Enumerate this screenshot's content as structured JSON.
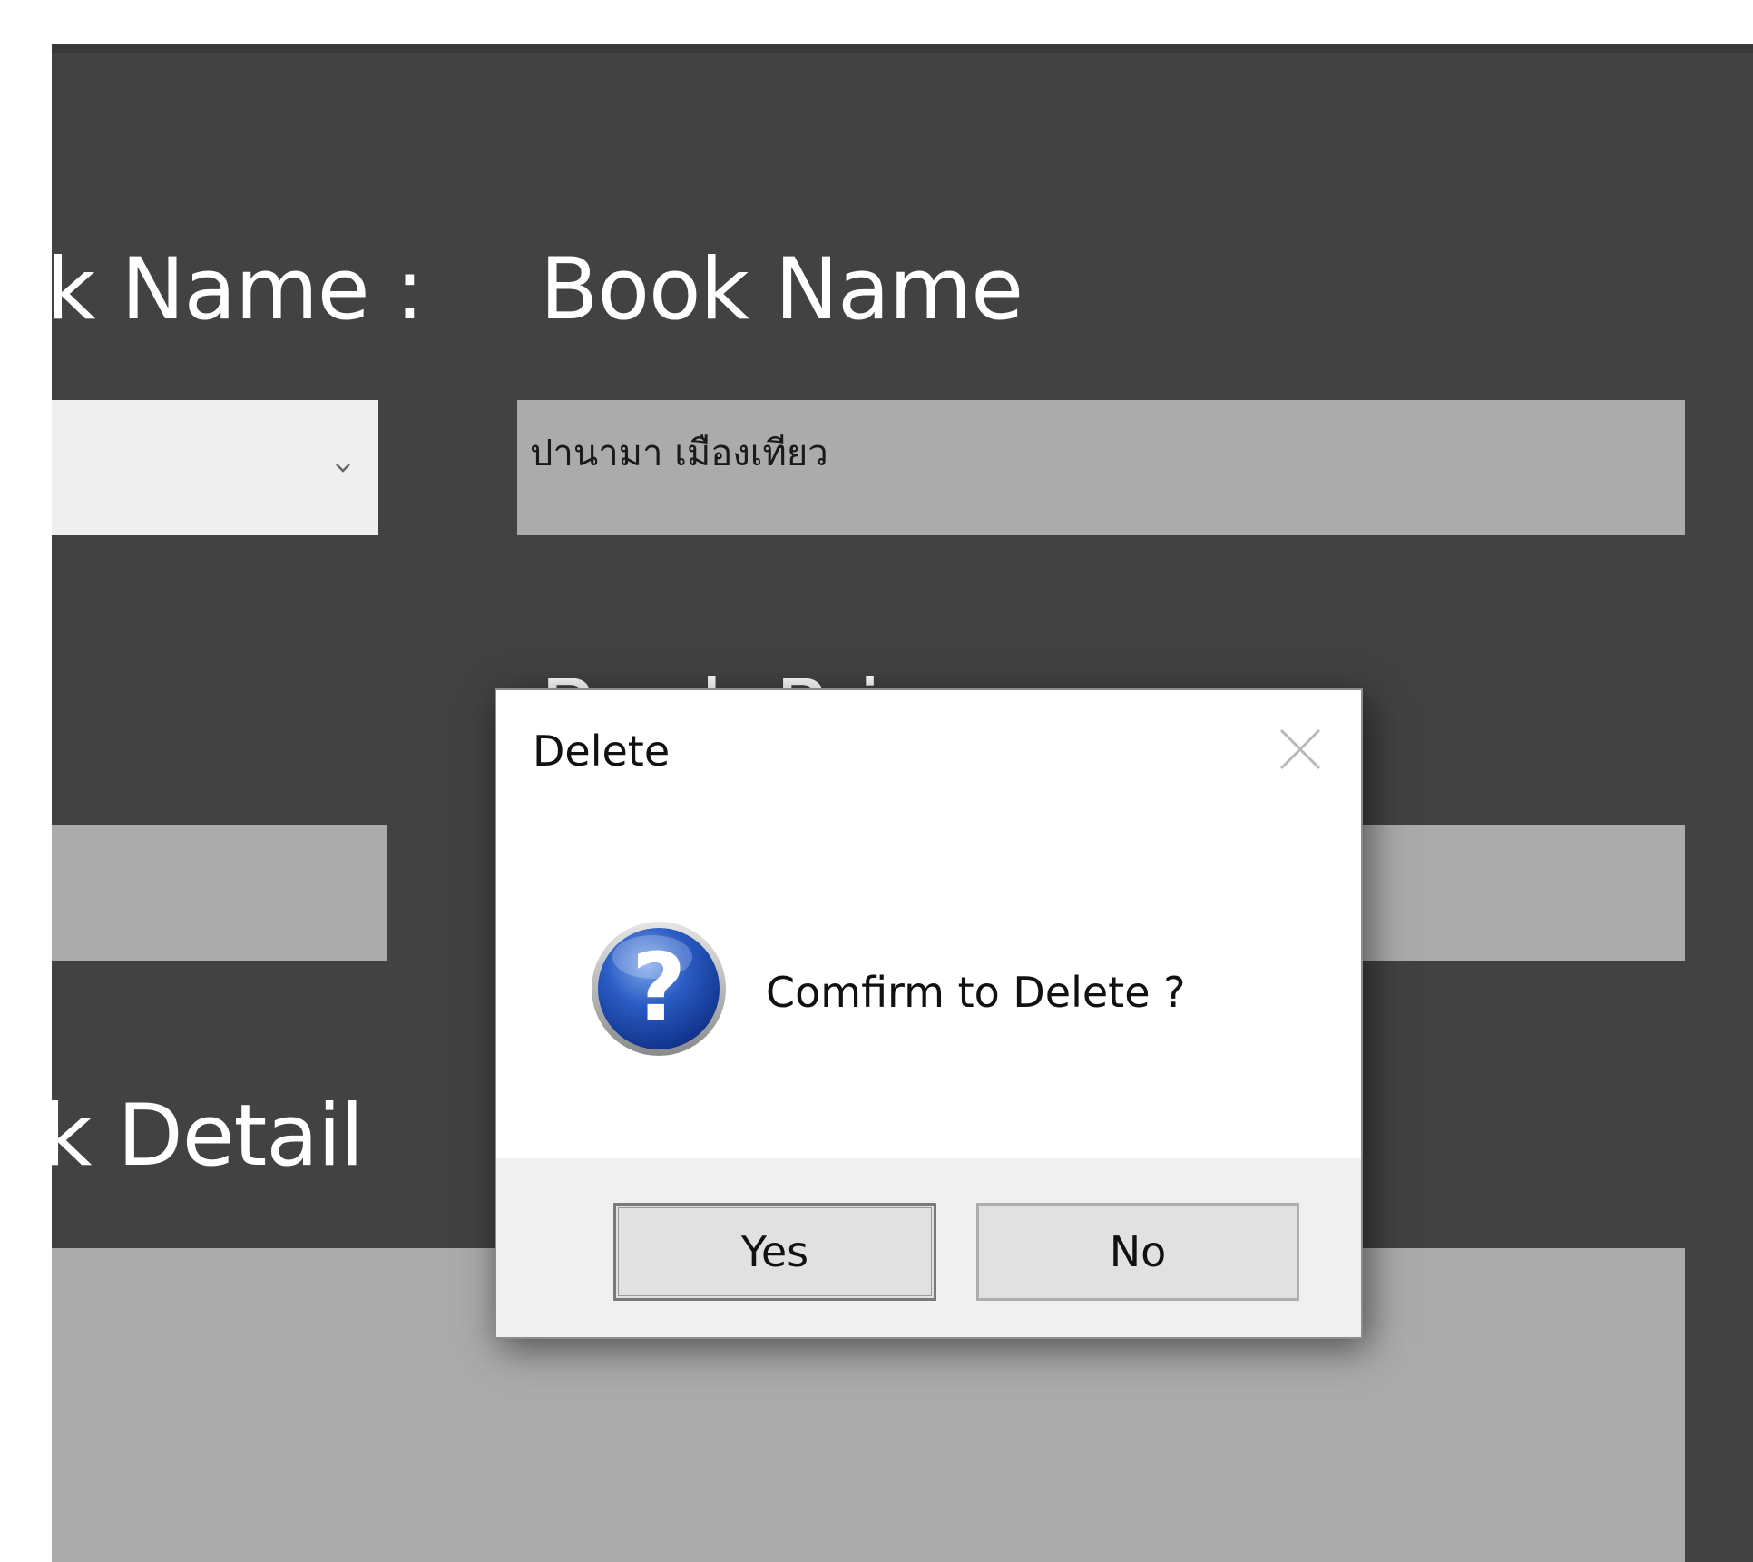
{
  "form": {
    "book_name_label_left": "k Name :",
    "book_name_label": "Book Name",
    "book_name_value": "ปานามา เมืองเทียว",
    "book_price_label_partial": "Book Price",
    "book_detail_label_left": "k Detail"
  },
  "dialog": {
    "title": "Delete",
    "message": "Comfirm to Delete ?",
    "yes_label": "Yes",
    "no_label": "No",
    "icon": "question-icon",
    "close_icon": "close-icon"
  },
  "colors": {
    "window_bg": "#424242",
    "field_bg": "#ababab",
    "combo_bg": "#efefef",
    "dialog_bg": "#ffffff",
    "dialog_footer_bg": "#f0f0f0"
  }
}
